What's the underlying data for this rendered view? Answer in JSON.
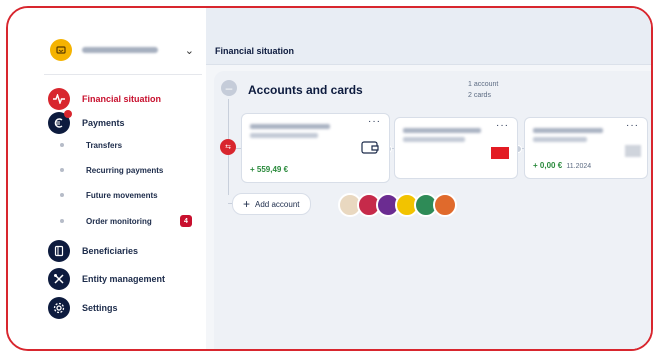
{
  "sidebar": {
    "account_selector": {
      "chevron": "chevron-down-icon"
    },
    "items": [
      {
        "label": "Financial situation",
        "icon": "pulse-icon"
      },
      {
        "label": "Payments",
        "icon": "euro-icon"
      },
      {
        "label": "Beneficiaries",
        "icon": "phonebook-icon"
      },
      {
        "label": "Entity management",
        "icon": "tools-icon"
      },
      {
        "label": "Settings",
        "icon": "gear-icon"
      }
    ],
    "sub_items": [
      {
        "label": "Transfers"
      },
      {
        "label": "Recurring payments"
      },
      {
        "label": "Future movements"
      },
      {
        "label": "Order monitoring",
        "badge": "4"
      }
    ]
  },
  "header": {
    "title": "Financial situation"
  },
  "accounts_panel": {
    "title": "Accounts and cards",
    "account_count": "1 account",
    "card_count": "2 cards",
    "collapse_symbol": "–",
    "add_account_label": "Add account",
    "cards": [
      {
        "amount": "+ 559,49 €",
        "more": "···"
      },
      {
        "more": "···"
      },
      {
        "amount": "+ 0,00 €",
        "date": "11.2024",
        "more": "···"
      }
    ]
  },
  "colors": {
    "accent": "#d8262e",
    "navy": "#0d1b3e",
    "positive": "#2a8a3c"
  }
}
